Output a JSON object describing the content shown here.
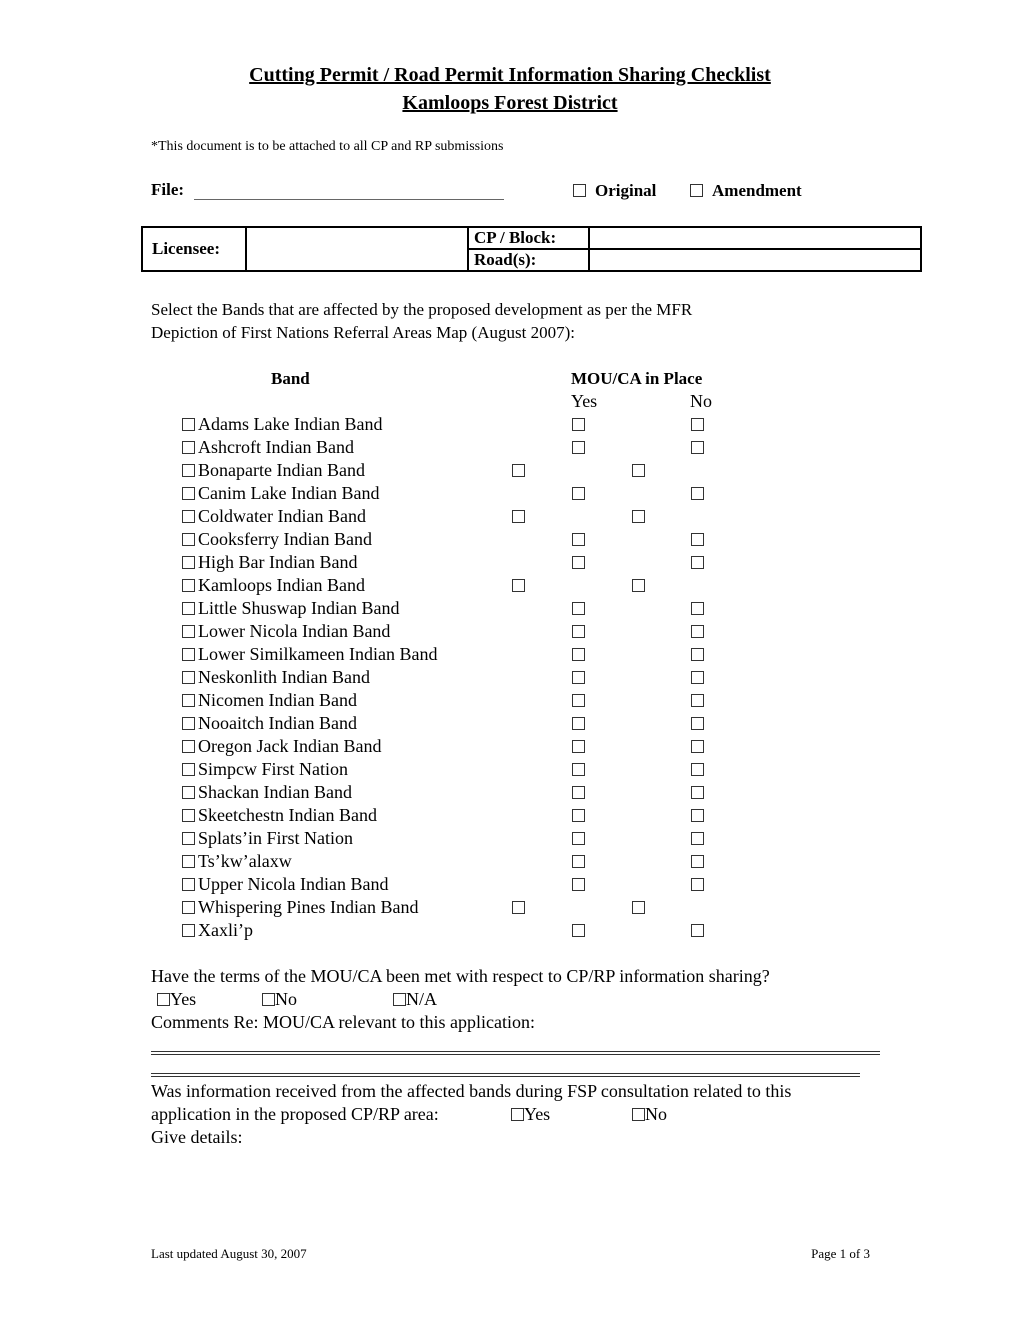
{
  "header": {
    "title": "Cutting Permit / Road Permit Information Sharing Checklist",
    "subtitle": "Kamloops Forest District",
    "note": "*This document is to be attached to all CP and RP submissions"
  },
  "file": {
    "label": "File:",
    "value": "",
    "options": [
      "Original",
      "Amendment"
    ]
  },
  "licensee_table": {
    "licensee_label": "Licensee:",
    "licensee_value": "",
    "cp_block_label": "CP / Block:",
    "cp_block_value": "",
    "roads_label": "Road(s):",
    "roads_value": ""
  },
  "instructions": {
    "line1": "Select the Bands that are affected by the proposed development as per the MFR",
    "line2": "Depiction of First Nations Referral Areas Map (August 2007):"
  },
  "bands_table": {
    "band_header": "Band",
    "mou_header": "MOU/CA in Place",
    "yes_header": "Yes",
    "no_header": "No",
    "rows": [
      {
        "name": "Adams Lake Indian Band",
        "offset": false
      },
      {
        "name": "Ashcroft Indian Band",
        "offset": false
      },
      {
        "name": "Bonaparte Indian Band",
        "offset": true
      },
      {
        "name": "Canim Lake Indian Band",
        "offset": false
      },
      {
        "name": "Coldwater Indian Band",
        "offset": true
      },
      {
        "name": "Cooksferry Indian Band",
        "offset": false
      },
      {
        "name": "High Bar Indian Band",
        "offset": false
      },
      {
        "name": "Kamloops Indian Band",
        "offset": true
      },
      {
        "name": "Little Shuswap Indian Band",
        "offset": false
      },
      {
        "name": "Lower Nicola Indian Band",
        "offset": false
      },
      {
        "name": "Lower Similkameen Indian Band",
        "offset": false
      },
      {
        "name": "Neskonlith Indian Band",
        "offset": false
      },
      {
        "name": "Nicomen Indian Band",
        "offset": false
      },
      {
        "name": "Nooaitch Indian Band",
        "offset": false
      },
      {
        "name": "Oregon Jack Indian Band",
        "offset": false
      },
      {
        "name": "Simpcw First Nation",
        "offset": false
      },
      {
        "name": "Shackan Indian Band",
        "offset": false
      },
      {
        "name": "Skeetchestn Indian Band",
        "offset": false
      },
      {
        "name": "Splats’in First Nation",
        "offset": false
      },
      {
        "name": "Ts’kw’alaxw",
        "offset": false
      },
      {
        "name": "Upper Nicola Indian Band",
        "offset": false
      },
      {
        "name": "Whispering Pines Indian Band",
        "offset": true
      },
      {
        "name": "Xaxli’p",
        "offset": false
      }
    ]
  },
  "mou_terms": {
    "question": "Have the terms of the MOU/CA been met with respect to CP/RP information sharing?",
    "options": [
      "Yes",
      "No",
      "N/A"
    ],
    "comments_label": "Comments Re: MOU/CA relevant to this application:"
  },
  "fsp_info": {
    "question_line1": "Was information received from the affected bands during FSP consultation related to this",
    "question_line2": "application in the proposed CP/RP area:",
    "options": [
      "Yes",
      "No"
    ],
    "details_label": "Give details:"
  },
  "footer": {
    "last_updated": "Last updated August 30, 2007",
    "page": "Page 1 of 3"
  }
}
